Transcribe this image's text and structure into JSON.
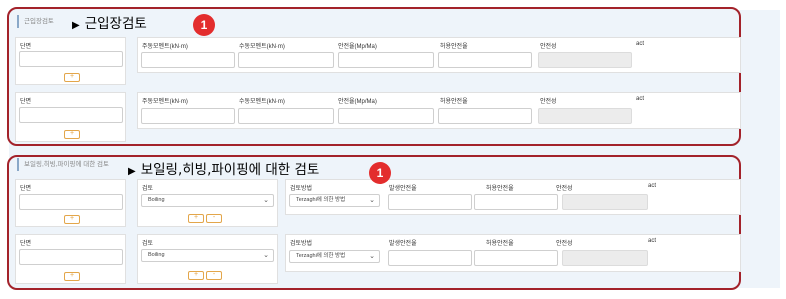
{
  "section1": {
    "label": "근입장검토",
    "annotation": "근입장검토",
    "arrow": "▶",
    "badge": "1",
    "rows": [
      {
        "section_field": "단면",
        "add_btn": "+",
        "cols": [
          "주동모멘트(kN·m)",
          "수동모멘트(kN·m)",
          "안전율(Mp/Ma)",
          "허용안전율",
          "안전성",
          "act"
        ]
      },
      {
        "section_field": "단면",
        "add_btn": "+",
        "cols": [
          "주동모멘트(kN·m)",
          "수동모멘트(kN·m)",
          "안전율(Mp/Ma)",
          "허용안전율",
          "안전성",
          "act"
        ]
      }
    ]
  },
  "section2": {
    "label": "보일링,히빙,파이핑에 대한 검토",
    "annotation": "보일링,히빙,파이핑에 대한 검토",
    "arrow": "▶",
    "badge": "1",
    "rows": [
      {
        "section_field": "단면",
        "add_btn": "+",
        "check_label": "검토",
        "check_value": "Boiling",
        "plus": "+",
        "minus": "-",
        "method_label": "검토방법",
        "method_value": "Terzaghi에 의한 방법",
        "cols": [
          "발생안전율",
          "허용안전율",
          "안전성",
          "act"
        ]
      },
      {
        "section_field": "단면",
        "add_btn": "+",
        "check_label": "검토",
        "check_value": "Boiling",
        "plus": "+",
        "minus": "-",
        "method_label": "검토방법",
        "method_value": "Terzaghi에 의한 방법",
        "cols": [
          "발생안전율",
          "허용안전율",
          "안전성",
          "act"
        ]
      }
    ]
  }
}
